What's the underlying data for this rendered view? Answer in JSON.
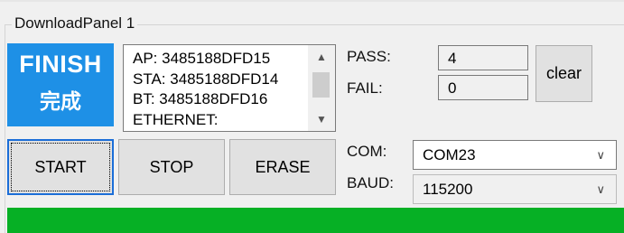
{
  "panel": {
    "title": "DownloadPanel 1"
  },
  "status": {
    "label_en": "FINISH",
    "label_zh": "完成",
    "color": "#1e90e6"
  },
  "mac_list": {
    "items": [
      "AP: 3485188DFD15",
      "STA: 3485188DFD14",
      "BT: 3485188DFD16",
      "ETHERNET:"
    ]
  },
  "counts": {
    "pass_label": "PASS:",
    "pass_value": "4",
    "fail_label": "FAIL:",
    "fail_value": "0"
  },
  "clear_button": {
    "label": "clear"
  },
  "actions": {
    "start_label": "START",
    "stop_label": "STOP",
    "erase_label": "ERASE"
  },
  "com": {
    "label": "COM:",
    "value": "COM23"
  },
  "baud": {
    "label": "BAUD:",
    "value": "115200"
  },
  "progress": {
    "value": 1.0,
    "color": "#06b025"
  }
}
